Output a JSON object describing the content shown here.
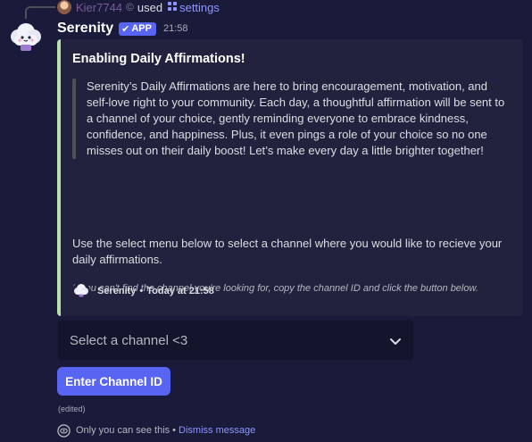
{
  "reply": {
    "user": "Kier7744",
    "separator": "©",
    "action": "used",
    "slash_icon": "slash-command-icon",
    "command": "settings"
  },
  "message": {
    "author": "Serenity",
    "badge": "APP",
    "badge_icon": "check-icon",
    "timestamp": "21:58"
  },
  "embed": {
    "accent_color": "#b2e2a6",
    "title": "Enabling Daily Affirmations!",
    "quote": "Serenity’s Daily Affirmations are here to bring encouragement, motivation, and self-love right to your community. Each day, a thoughtful affirmation will be sent to a channel of your choice, gently reminding everyone to embrace kindness, confidence, and happiness. Plus, it even pings a role of your choice so no one misses out on their daily boost! Let’s make every day a little brighter together!",
    "body": "Use the select menu below to select a channel where you would like to recieve your daily affirmations.",
    "note": "If you can't find the channel you're looking for, copy the channel ID and click the button below.",
    "footer": {
      "name": "Serenity",
      "separator": "•",
      "time": "Today at 21:58"
    }
  },
  "select": {
    "placeholder": "Select a channel <3"
  },
  "button": {
    "label": "Enter Channel ID",
    "color": "#5865f2"
  },
  "edited_label": "(edited)",
  "ephemeral": {
    "text": "Only you can see this",
    "separator": "•",
    "dismiss": "Dismiss message"
  }
}
